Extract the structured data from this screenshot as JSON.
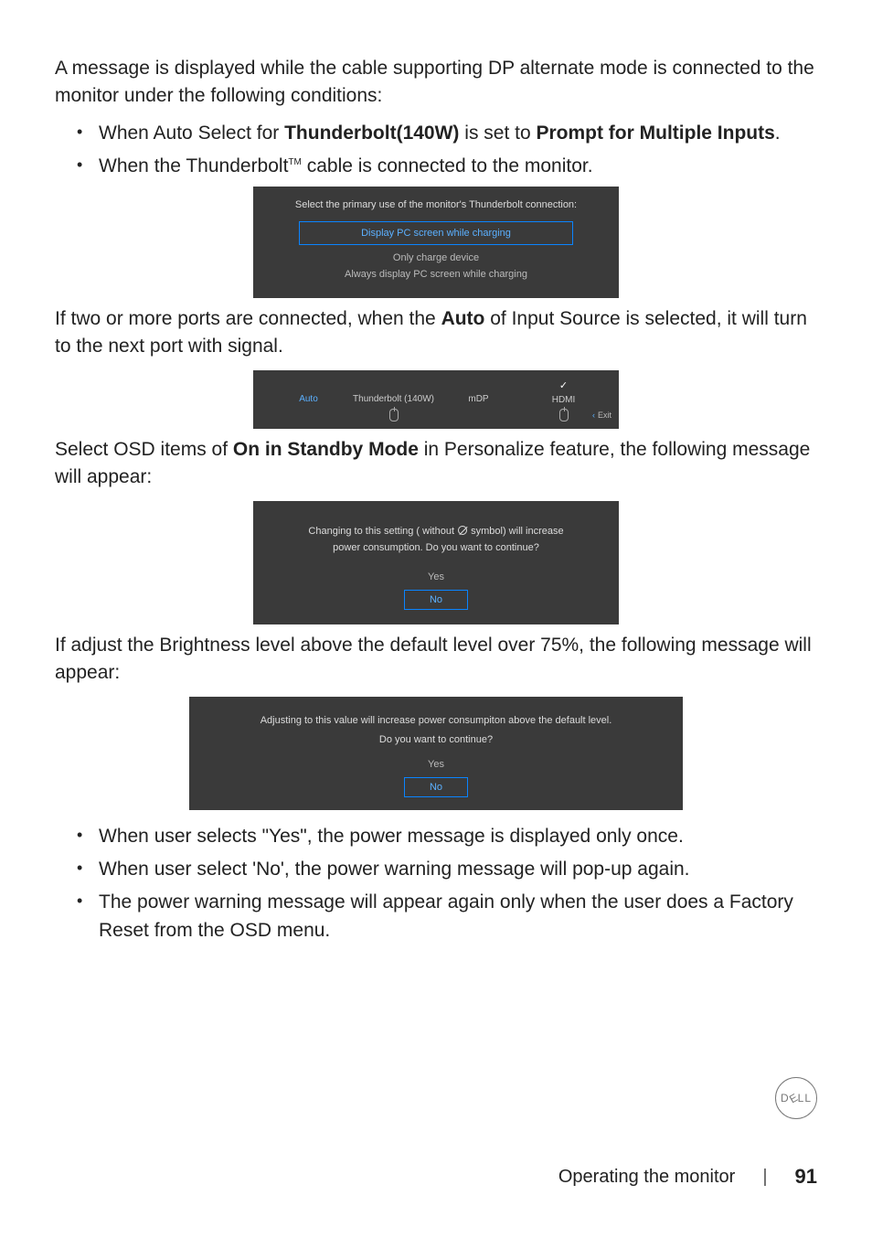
{
  "intro": "A message is displayed while the cable supporting DP alternate mode is connected to the monitor under the following conditions:",
  "bullets_top": [
    {
      "pre": "When Auto Select for ",
      "bold": "Thunderbolt(140W)",
      "mid": " is set to ",
      "bold2": "Prompt for Multiple Inputs",
      "post": "."
    },
    {
      "plain": "When the Thunderbolt",
      "tm": "TM",
      "tail": " cable is connected to the monitor."
    }
  ],
  "osd1": {
    "title": "Select the primary use of the monitor's Thunderbolt connection:",
    "opt_highlight": "Display PC screen while charging",
    "opt2": "Only charge device",
    "opt3": "Always display PC screen while charging"
  },
  "para2_a": "If two or more ports are connected, when the ",
  "para2_b": "Auto",
  "para2_c": " of Input Source is selected, it will turn to the next port with signal.",
  "osd2": {
    "cols": [
      "Auto",
      "Thunderbolt (140W)",
      "mDP",
      "HDMI"
    ],
    "exit": "Exit"
  },
  "para3_a": "Select OSD items of ",
  "para3_b": "On in Standby Mode",
  "para3_c": " in Personalize feature, the following message will appear:",
  "osd3": {
    "line1": "Changing to this setting ( without ",
    "line1b": " symbol) will increase",
    "line2": "power consumption. Do you want to continue?",
    "yes": "Yes",
    "no": "No"
  },
  "para4": "If adjust the Brightness level above the default level over 75%, the following message will appear:",
  "osd4": {
    "line1": "Adjusting to this value will increase power consumpiton above the default level.",
    "line2": "Do you want to continue?",
    "yes": "Yes",
    "no": "No"
  },
  "bullets_bottom": [
    "When user selects \"Yes\", the power message is displayed only once.",
    "When user select 'No', the power warning message will pop-up again.",
    "The power warning message will appear again only when the user does a Factory Reset from the OSD menu."
  ],
  "footer": {
    "title": "Operating the monitor",
    "bar": "|",
    "page": "91"
  },
  "logo": "D LL"
}
